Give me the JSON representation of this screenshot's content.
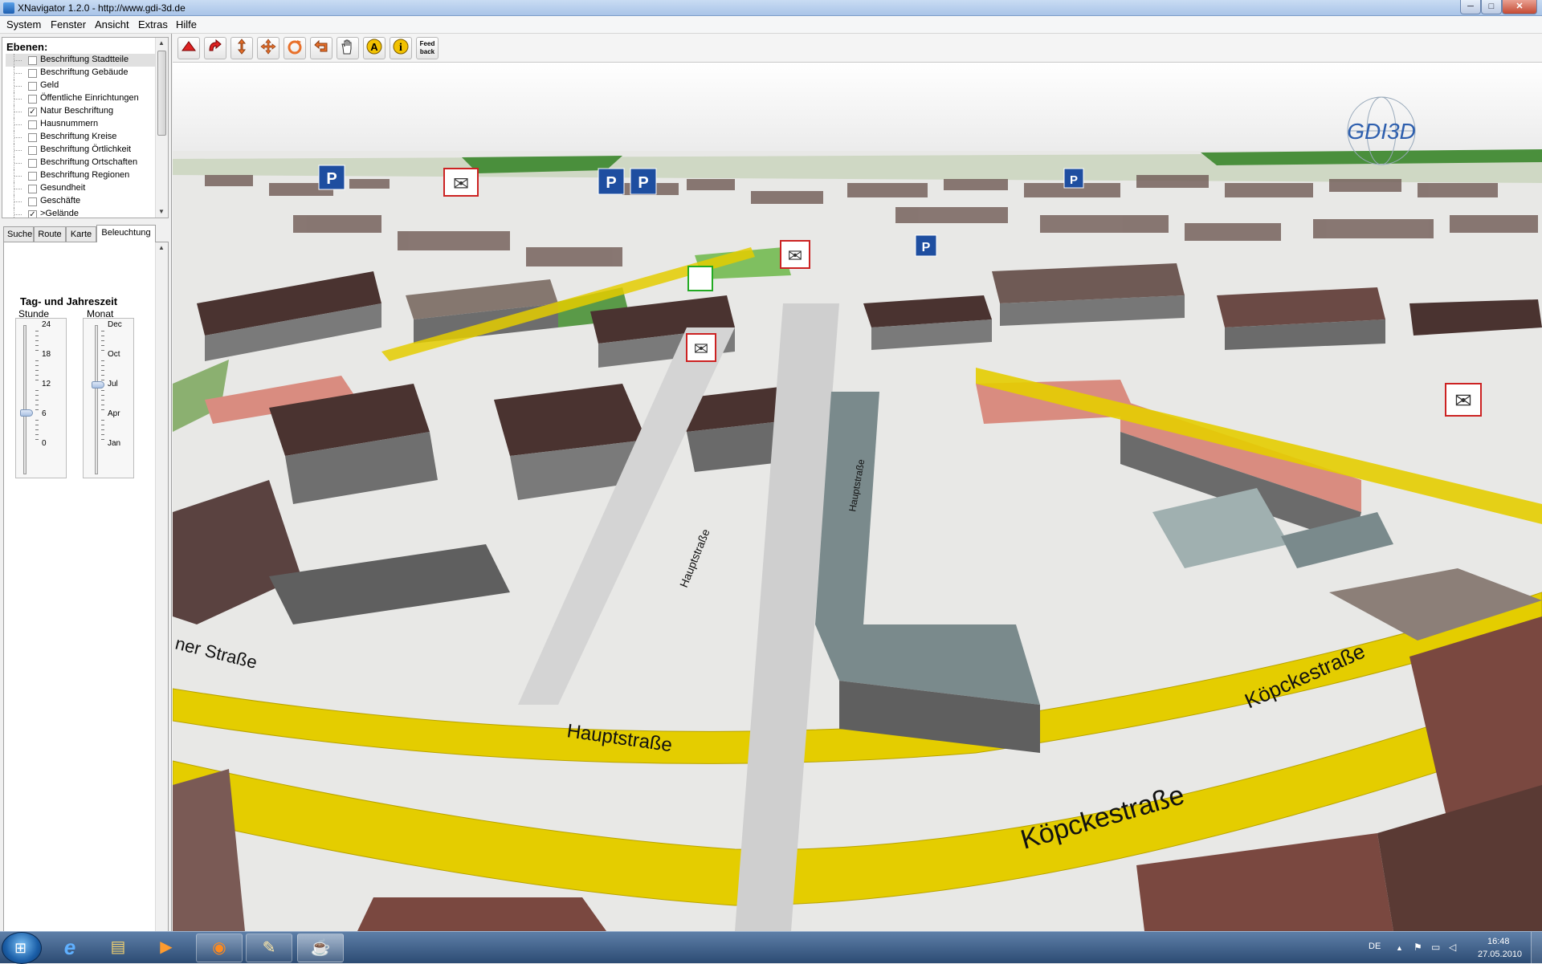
{
  "window": {
    "title": "XNavigator 1.2.0 - http://www.gdi-3d.de",
    "min_label": "─",
    "max_label": "□",
    "close_label": "✕"
  },
  "menu": [
    "System",
    "Fenster",
    "Ansicht",
    "Extras",
    "Hilfe"
  ],
  "layers": {
    "title": "Ebenen:",
    "items": [
      {
        "label": "Beschriftung Stadtteile",
        "checked": false
      },
      {
        "label": "Beschriftung Gebäude",
        "checked": false
      },
      {
        "label": "Geld",
        "checked": false
      },
      {
        "label": "Öffentliche Einrichtungen",
        "checked": false
      },
      {
        "label": "Natur Beschriftung",
        "checked": true
      },
      {
        "label": "Hausnummern",
        "checked": false
      },
      {
        "label": "Beschriftung Kreise",
        "checked": false
      },
      {
        "label": "Beschriftung Örtlichkeit",
        "checked": false
      },
      {
        "label": "Beschriftung Ortschaften",
        "checked": false
      },
      {
        "label": "Beschriftung Regionen",
        "checked": false
      },
      {
        "label": "Gesundheit",
        "checked": false
      },
      {
        "label": "Geschäfte",
        "checked": false
      },
      {
        "label": ">Gelände",
        "checked": true
      }
    ]
  },
  "tabs": [
    "Suche",
    "Route",
    "Karte",
    "Beleuchtung"
  ],
  "lighting": {
    "title": "Tag- und Jahreszeit",
    "hour_label": "Stunde",
    "month_label": "Monat",
    "hour_ticks": [
      "24",
      "18",
      "12",
      "6",
      "0"
    ],
    "month_ticks": [
      "Dec",
      "Oct",
      "Jul",
      "Apr",
      "Jan"
    ],
    "hour_value": 7,
    "month_value": "Jul"
  },
  "toolbar": {
    "icons": [
      "pan-red-icon",
      "rotate-red-icon",
      "move-orange-icon",
      "move-cross-icon",
      "orbit-icon",
      "back-arrow-icon",
      "hand-icon",
      "text-label-icon",
      "info-icon",
      "feedback-icon"
    ],
    "text_label_glyph": "A",
    "info_glyph": "i",
    "feedback_line1": "Feed",
    "feedback_line2": "back"
  },
  "map": {
    "logo": "GDI3D",
    "streets": [
      "Hauptstraße",
      "Köpckestraße",
      "Köpckestraße",
      "Hauptstraße",
      "Hauptstraße",
      "ner Straße"
    ],
    "poi_parking_glyph": "P",
    "poi_mail_glyph": "✉",
    "colors": {
      "road_yellow": "#e4cd00",
      "building_dark": "#4a3330",
      "building_grey": "#7a7a7a",
      "grass": "#4a8f3c",
      "sky": "#f4f4f4"
    }
  },
  "taskbar": {
    "apps": [
      "start-orb",
      "internet-explorer-icon",
      "file-explorer-icon",
      "media-player-icon",
      "firefox-icon",
      "paint-icon",
      "java-icon"
    ],
    "start_glyph": "⊞",
    "ie_glyph": "e",
    "explorer_glyph": "▤",
    "media_glyph": "▶",
    "firefox_glyph": "◉",
    "paint_glyph": "✎",
    "java_glyph": "☕",
    "language": "DE",
    "tray_up": "▲",
    "tray_flag": "⚑",
    "tray_net": "▭",
    "tray_vol": "◁",
    "time": "16:48",
    "date": "27.05.2010"
  }
}
